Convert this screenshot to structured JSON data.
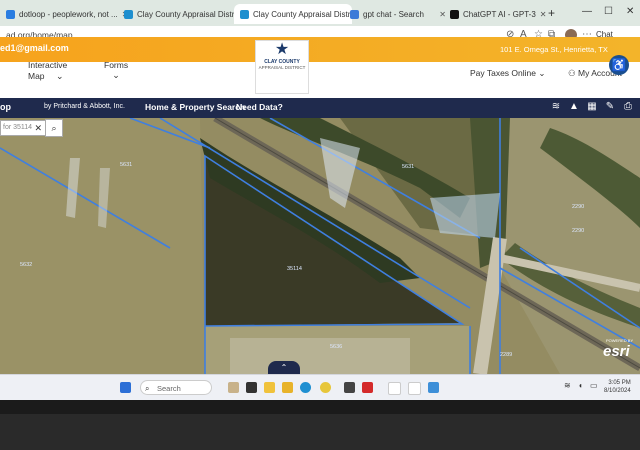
{
  "tabs": [
    {
      "label": "dotloop - peoplework, not ...",
      "color": "#2a7de1",
      "active": false
    },
    {
      "label": "Clay County Appraisal Distr...",
      "color": "#1e8fcf",
      "active": false
    },
    {
      "label": "Clay County Appraisal Distr...",
      "color": "#1e8fcf",
      "active": true
    },
    {
      "label": "gpt chat - Search",
      "color": "#3c7bd8",
      "active": false
    },
    {
      "label": "ChatGPT AI - GPT-3",
      "color": "#111111",
      "active": false
    }
  ],
  "addressbar": {
    "url": "ad.org/home/map",
    "chat_label": "Chat"
  },
  "orange_bar": {
    "email": "ed1@gmail.com",
    "address": "101 E. Omega St., Henrietta, TX"
  },
  "nav": {
    "interactive_map": [
      "Interactive",
      "Map"
    ],
    "forms": "Forms",
    "logo_line1": "CLAY COUNTY",
    "logo_line2": "APPRAISAL DISTRICT",
    "pay_taxes": "Pay Taxes Online",
    "my_account": "My Account"
  },
  "appbar": {
    "app_name": "op",
    "by_line": "by Pritchard & Abbott, Inc.",
    "home_search": "Home & Property Search",
    "need_data": "Need Data?"
  },
  "map": {
    "search_value": "for 35114",
    "parcel_labels": [
      "5631",
      "5631",
      "5632",
      "35114",
      "2290",
      "2290",
      "5636",
      "2289"
    ],
    "esri": "esri",
    "esri_powered": "POWERED BY"
  },
  "taskbar": {
    "search": "Search",
    "time": "3:05 PM",
    "date": "8/10/2024"
  },
  "colors": {
    "orange": "#f6a31d",
    "appbar": "#1f2a4d",
    "parcel_line": "#3f7fe0"
  }
}
